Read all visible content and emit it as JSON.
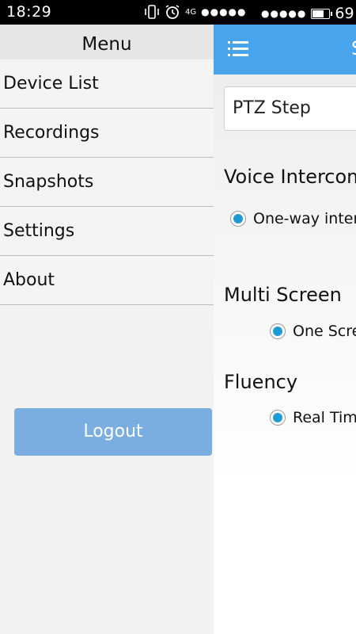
{
  "status_bar": {
    "time": "18:29",
    "network": "4G",
    "signal_dots": "●●●●●",
    "signal_dots_2": "●●●●●",
    "battery_level": "69",
    "battery_fill_fraction": 0.69
  },
  "drawer": {
    "title": "Menu",
    "items": [
      {
        "label": "Device List"
      },
      {
        "label": "Recordings"
      },
      {
        "label": "Snapshots"
      },
      {
        "label": "Settings"
      },
      {
        "label": "About"
      }
    ],
    "logout_label": "Logout"
  },
  "settings": {
    "header_title": "S",
    "ptz_label": "PTZ Step",
    "voice_title": "Voice Intercom",
    "voice_option": "One-way intercom",
    "multi_title": "Multi Screen",
    "multi_option": "One Screen",
    "fluency_title": "Fluency",
    "fluency_option": "Real Time"
  },
  "colors": {
    "app_bar": "#49a4ee",
    "logout_button": "#7aaee0",
    "radio_selected": "#1f9bd4"
  }
}
